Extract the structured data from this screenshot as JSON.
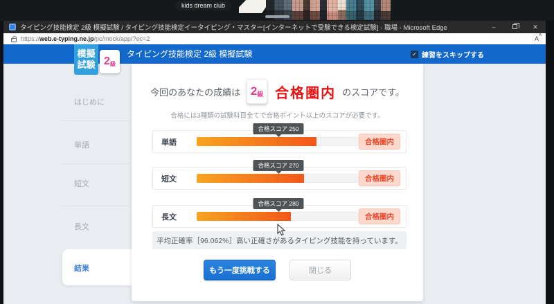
{
  "overlay": {
    "participant_label": "kids dream club"
  },
  "browser": {
    "window_title": "タイピング技能検定 2級 模擬試験 / タイピング技能検定イータイピング・マスター[インターネットで受験できる検定試験] - 職場 - Microsoft Edge",
    "url_protocol": "https://",
    "url_domain": "web.e-typing.ne.jp",
    "url_path": "/pc/mock/app/?ec=2"
  },
  "icons": {
    "minimize_glyph": "–",
    "close_glyph": "✕",
    "check_glyph": "✓",
    "text_size_glyph": "A",
    "text_size_superscript": "A"
  },
  "header": {
    "logo_top": "模擬",
    "logo_bottom": "試験",
    "grade_number": "2",
    "grade_suffix": "級",
    "title": "タイピング技能検定 2級 模擬試験",
    "skip_label": "練習をスキップする",
    "skip_checked": true
  },
  "sidebar": {
    "items": [
      {
        "label": "はじめに",
        "active": false
      },
      {
        "label": "単語",
        "active": false
      },
      {
        "label": "短文",
        "active": false
      },
      {
        "label": "長文",
        "active": false
      },
      {
        "label": "結果",
        "active": true
      }
    ]
  },
  "result": {
    "headline_prefix": "今回のあなたの成績は",
    "grade_number": "2",
    "grade_suffix": "級",
    "verdict": "合格圏内",
    "headline_suffix": "のスコアです。",
    "note": "合格には3種類の試験科目全てで合格ポイント以上のスコアが必要です。",
    "accuracy_text": "平均正確率［96.062%］高い正確さがあるタイピング技能を持っています。",
    "accuracy_percent": 96.062,
    "retry_button": "もう一度挑戦する",
    "close_button": "閉じる"
  },
  "scores": {
    "rows": [
      {
        "label": "単語",
        "tooltip": "合格スコア 250",
        "pass_score": 250,
        "fill_width": "74%",
        "status": "合格圏内"
      },
      {
        "label": "短文",
        "tooltip": "合格スコア 270",
        "pass_score": 270,
        "fill_width": "66%",
        "status": "合格圏内"
      },
      {
        "label": "長文",
        "tooltip": "合格スコア 280",
        "pass_score": 280,
        "fill_width": "58%",
        "status": "合格圏内"
      }
    ]
  },
  "colors": {
    "header_blue": "#1368cb",
    "logo_blue": "#31a0dd",
    "grade_pink": "#e23a8e",
    "verdict_red": "#e81212",
    "bar_gradient_start": "#f8a41f",
    "bar_gradient_end": "#f3571a",
    "status_badge_bg": "#fcd9cc",
    "status_badge_text": "#ea4527",
    "active_tab_text": "#4285d6"
  }
}
